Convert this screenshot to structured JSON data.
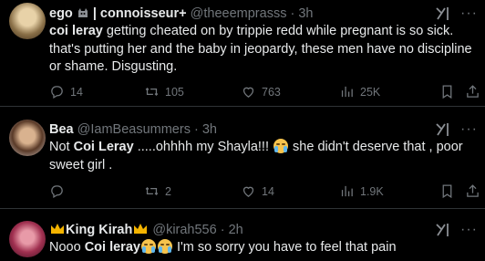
{
  "tweets": [
    {
      "name": "ego",
      "name_suffix": "| connoisseur+",
      "handle": "@theeemprasss",
      "sep": "·",
      "time": "3h",
      "text_bold": "coi leray",
      "text_rest": " getting cheated on by trippie redd while pregnant is so sick. that's putting her and the baby in jeopardy, these men have no discipline or shame. Disgusting.",
      "replies": "14",
      "reposts": "105",
      "likes": "763",
      "views": "25K"
    },
    {
      "name": "Bea",
      "handle": "@IamBeasummers",
      "sep": "·",
      "time": "3h",
      "text_pre": "Not ",
      "text_bold": "Coi Leray",
      "text_mid": " .....ohhhh my Shayla!!! ",
      "text_post": " she didn't deserve that , poor sweet girl .",
      "replies": "",
      "reposts": "2",
      "likes": "14",
      "views": "1.9K"
    },
    {
      "name": "King Kirah",
      "handle": "@kirah556",
      "sep": "·",
      "time": "2h",
      "text_pre": "Nooo ",
      "text_bold": "Coi leray",
      "text_post": " I'm so sorry you have to feel that pain"
    }
  ],
  "icons": {
    "reply": "reply-icon",
    "repost": "repost-icon",
    "like": "like-icon",
    "views": "views-icon",
    "bookmark": "bookmark-icon",
    "share": "share-icon",
    "grok": "grok-icon",
    "more": "more-icon"
  }
}
